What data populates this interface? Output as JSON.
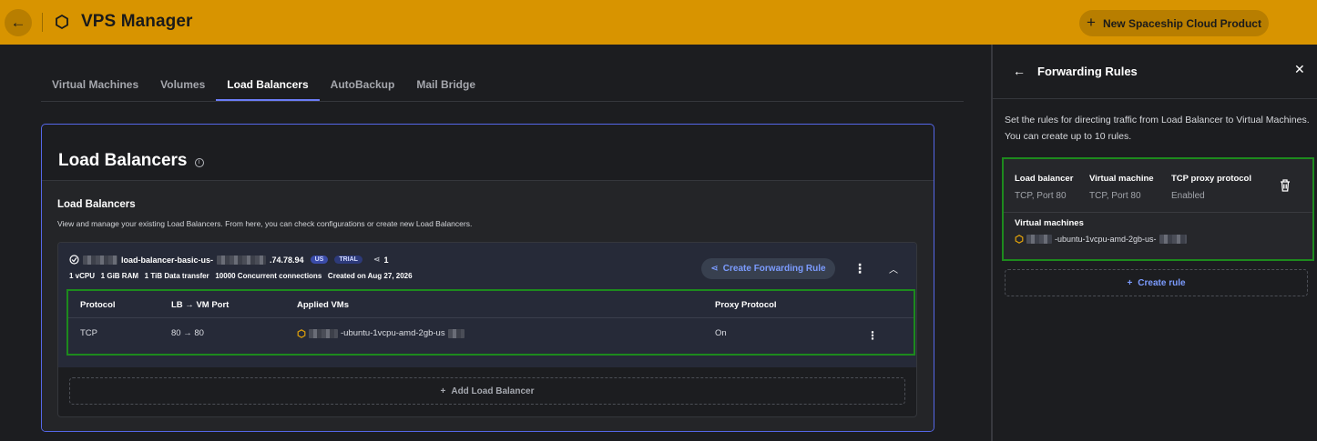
{
  "header": {
    "back_icon": "arrow-left",
    "app_icon": "hexagon-icon",
    "title": "VPS Manager",
    "new_product_label": "New Spaceship Cloud Product"
  },
  "tabs": [
    {
      "label": "Virtual Machines",
      "active": false
    },
    {
      "label": "Volumes",
      "active": false
    },
    {
      "label": "Load Balancers",
      "active": true
    },
    {
      "label": "AutoBackup",
      "active": false
    },
    {
      "label": "Mail Bridge",
      "active": false
    }
  ],
  "card": {
    "title": "Load Balancers",
    "section_title": "Load Balancers",
    "section_desc": "View and manage your existing Load Balancers. From here, you can check configurations or create new Load Balancers.",
    "add_label": "Add Load Balancer"
  },
  "load_balancer": {
    "name": "load-balancer-basic-us-",
    "ip_suffix": ".74.78.94",
    "badge_region": "US",
    "badge_trial": "TRIAL",
    "rules_count": "1",
    "specs": "1 vCPU   1 GiB RAM   1 TiB Data transfer   10000 Concurrent connections   Created on Aug 27, 2026",
    "create_rule_label": "Create Forwarding Rule",
    "table": {
      "headers": [
        "Protocol",
        "LB → VM Port",
        "Applied VMs",
        "Proxy Protocol"
      ],
      "rows": [
        {
          "protocol": "TCP",
          "port": "80 → 80",
          "vm": "-ubuntu-1vcpu-amd-2gb-us",
          "proxy": "On"
        }
      ]
    }
  },
  "panel": {
    "title": "Forwarding Rules",
    "description": "Set the rules for directing traffic from Load Balancer to Virtual Machines. You can create up to 10 rules.",
    "rule": {
      "lb_label": "Load balancer",
      "lb_value": "TCP, Port 80",
      "vm_label": "Virtual machine",
      "vm_value": "TCP, Port 80",
      "proxy_label": "TCP proxy protocol",
      "proxy_value": "Enabled",
      "vms_label": "Virtual machines",
      "vms_value": "-ubuntu-1vcpu-amd-2gb-us-"
    },
    "create_rule_label": "Create rule"
  },
  "colors": {
    "brand": "#d89400",
    "accent": "#6b7cf6",
    "highlight": "#1d8a1d"
  }
}
